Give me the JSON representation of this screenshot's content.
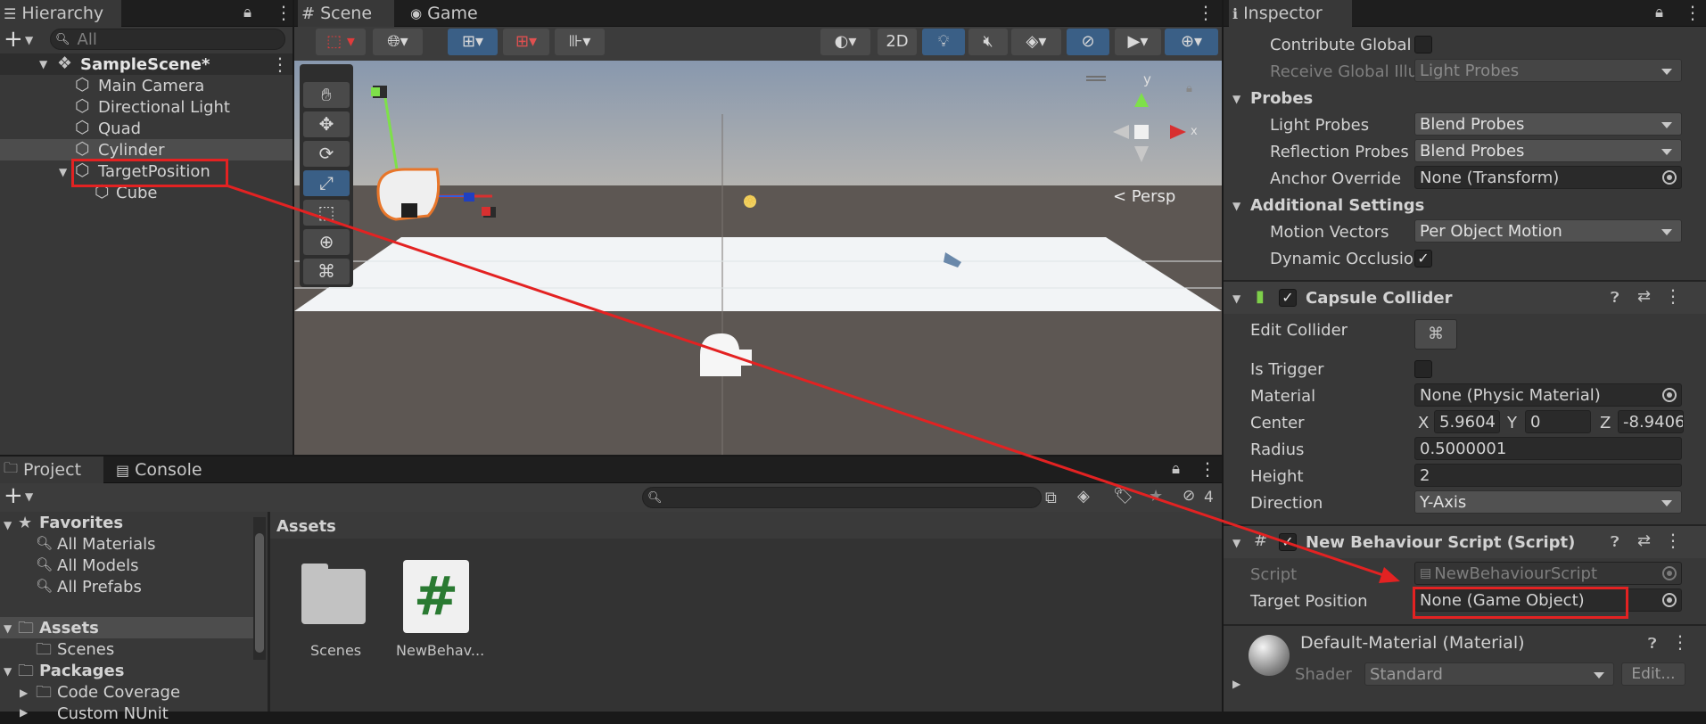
{
  "hierarchy": {
    "tab": "Hierarchy",
    "search_placeholder": "All",
    "scene": "SampleScene*",
    "items": [
      "Main Camera",
      "Directional Light",
      "Quad",
      "Cylinder",
      "TargetPosition",
      "Cube"
    ]
  },
  "scene_view": {
    "tabs": [
      "Scene",
      "Game"
    ],
    "toolbar_2d": "2D",
    "persp_label": "< Persp",
    "gizmo_y": "y",
    "gizmo_x": "x"
  },
  "project": {
    "tabs": [
      "Project",
      "Console"
    ],
    "hidden_count": "4",
    "favorites_label": "Favorites",
    "favorites": [
      "All Materials",
      "All Models",
      "All Prefabs"
    ],
    "assets_label": "Assets",
    "asset_children": [
      "Scenes"
    ],
    "packages_label": "Packages",
    "package_children": [
      "Code Coverage",
      "Custom NUnit"
    ],
    "breadcrumb": "Assets",
    "asset_items": [
      "Scenes",
      "NewBehav..."
    ]
  },
  "inspector": {
    "tab": "Inspector",
    "contribute_global": "Contribute Global",
    "receive_global": "Receive Global Illu",
    "receive_global_value": "Light Probes",
    "probes": "Probes",
    "light_probes": "Light Probes",
    "light_probes_value": "Blend Probes",
    "reflection_probes": "Reflection Probes",
    "reflection_probes_value": "Blend Probes",
    "anchor_override": "Anchor Override",
    "anchor_override_value": "None (Transform)",
    "additional": "Additional Settings",
    "motion_vectors": "Motion Vectors",
    "motion_vectors_value": "Per Object Motion",
    "dynamic_occlusion": "Dynamic Occlusio",
    "capsule_title": "Capsule Collider",
    "edit_collider": "Edit Collider",
    "is_trigger": "Is Trigger",
    "material": "Material",
    "material_value": "None (Physic Material)",
    "center": "Center",
    "center_x_label": "X",
    "center_x": "5.9604",
    "center_y_label": "Y",
    "center_y": "0",
    "center_z_label": "Z",
    "center_z": "-8.9406",
    "radius": "Radius",
    "radius_value": "0.5000001",
    "height": "Height",
    "height_value": "2",
    "direction": "Direction",
    "direction_value": "Y-Axis",
    "script_title": "New Behaviour Script (Script)",
    "script_label": "Script",
    "script_value": "NewBehaviourScript",
    "target_label": "Target Position",
    "target_value": "None (Game Object)",
    "material_title": "Default-Material (Material)",
    "shader_label": "Shader",
    "shader_value": "Standard",
    "edit_button": "Edit..."
  },
  "colors": {
    "highlight": "#e32222",
    "selection": "#4d4d4d",
    "panel": "#383838",
    "accent_blue": "#3a5f86"
  }
}
